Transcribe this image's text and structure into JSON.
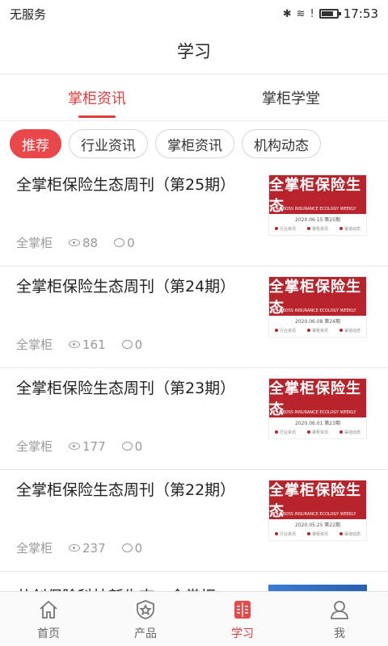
{
  "status_bar": {
    "carrier": "无服务",
    "time": "17:53"
  },
  "header": {
    "title": "学习"
  },
  "tabs": [
    {
      "label": "掌柜资讯",
      "active": true
    },
    {
      "label": "掌柜学堂",
      "active": false
    }
  ],
  "chips": [
    {
      "label": "推荐",
      "active": true
    },
    {
      "label": "行业资讯",
      "active": false
    },
    {
      "label": "掌柜资讯",
      "active": false
    },
    {
      "label": "机构动态",
      "active": false
    }
  ],
  "articles": [
    {
      "title": "全掌柜保险生态周刊（第25期）",
      "author": "全掌柜",
      "views": "88",
      "comments": "0",
      "thumb": {
        "banner": "全掌柜保险生态",
        "subtitle": "QBOSS INSURANCE ECOLOGY WEEKLY",
        "date": "2020.06.15 第25期",
        "tags": [
          "行业资讯",
          "掌柜资讯",
          "渠道动态"
        ]
      }
    },
    {
      "title": "全掌柜保险生态周刊（第24期）",
      "author": "全掌柜",
      "views": "161",
      "comments": "0",
      "thumb": {
        "banner": "全掌柜保险生态",
        "subtitle": "QBOSS INSURANCE ECOLOGY WEEKLY",
        "date": "2020.06.08 第24期",
        "tags": [
          "行业资讯",
          "掌柜资讯",
          "渠道动态"
        ]
      }
    },
    {
      "title": "全掌柜保险生态周刊（第23期）",
      "author": "全掌柜",
      "views": "177",
      "comments": "0",
      "thumb": {
        "banner": "全掌柜保险生态",
        "subtitle": "QBOSS INSURANCE ECOLOGY WEEKLY",
        "date": "2020.06.01 第23期",
        "tags": [
          "行业资讯",
          "掌柜资讯",
          "渠道动态"
        ]
      }
    },
    {
      "title": "全掌柜保险生态周刊（第22期）",
      "author": "全掌柜",
      "views": "237",
      "comments": "0",
      "thumb": {
        "banner": "全掌柜保险生态",
        "subtitle": "QBOSS INSURANCE ECOLOGY WEEKLY",
        "date": "2020.05.25 第22期",
        "tags": [
          "行业资讯",
          "掌柜资讯",
          "渠道动态"
        ]
      }
    }
  ],
  "partial_article": {
    "title": "共创保险科技新生态，全掌柜"
  },
  "bottom_nav": [
    {
      "label": "首页",
      "icon": "home-icon",
      "active": false
    },
    {
      "label": "产品",
      "icon": "product-shield-icon",
      "active": false
    },
    {
      "label": "学习",
      "icon": "book-icon",
      "active": true
    },
    {
      "label": "我",
      "icon": "user-icon",
      "active": false
    }
  ],
  "colors": {
    "accent": "#e53a3a",
    "thumb_red": "#b8232c"
  }
}
